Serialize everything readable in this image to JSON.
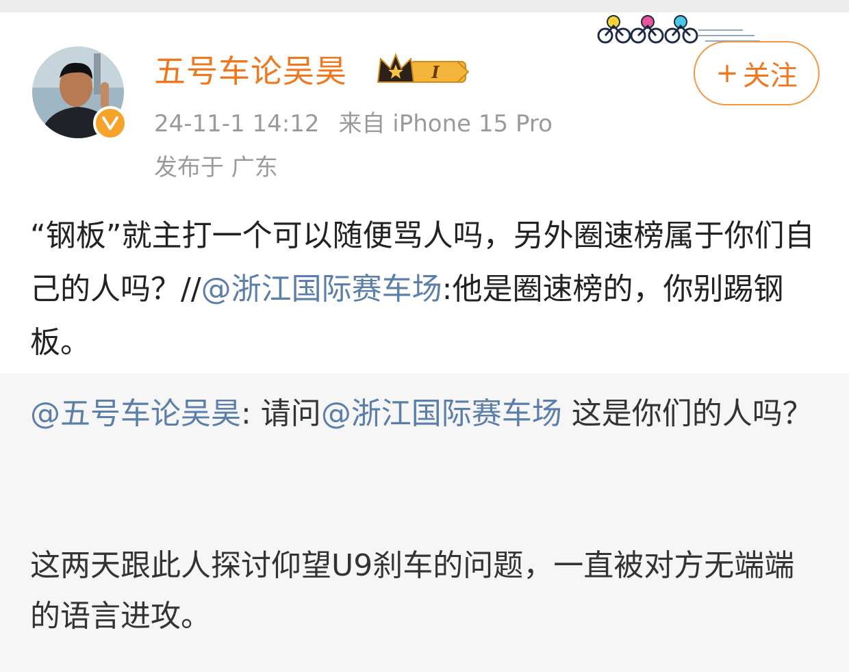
{
  "post": {
    "username": "五号车论吴昊",
    "level_badge": "I",
    "timestamp": "24-11-1 14:12",
    "source": "来自 iPhone 15 Pro",
    "location": "发布于 广东",
    "follow_plus": "+",
    "follow_label": "关注",
    "text_part1": "“钢板”就主打一个可以随便骂人吗，另外圈速榜属于你们自己的人吗？//",
    "text_mention": "@浙江国际赛车场",
    "text_part2": ":他是圈速榜的，你别踢钢板。"
  },
  "repost": {
    "author_mention": "@五号车论吴昊",
    "text_a": ": 请问",
    "mention2": "@浙江国际赛车场",
    "text_b": " 这是你们的人吗？",
    "paragraph2": "这两天跟此人探讨仰望U9刹车的问题，一直被对方无端端的语言进攻。"
  },
  "colors": {
    "accent_orange": "#f0771e",
    "mention_blue": "#5b7fa8",
    "meta_gray": "#9a9a9a",
    "repost_bg": "#f6f6f6"
  },
  "icons": {
    "verified": "verified-v-icon",
    "crown": "crown-level-icon",
    "decoration": "bike-riders-decoration"
  }
}
